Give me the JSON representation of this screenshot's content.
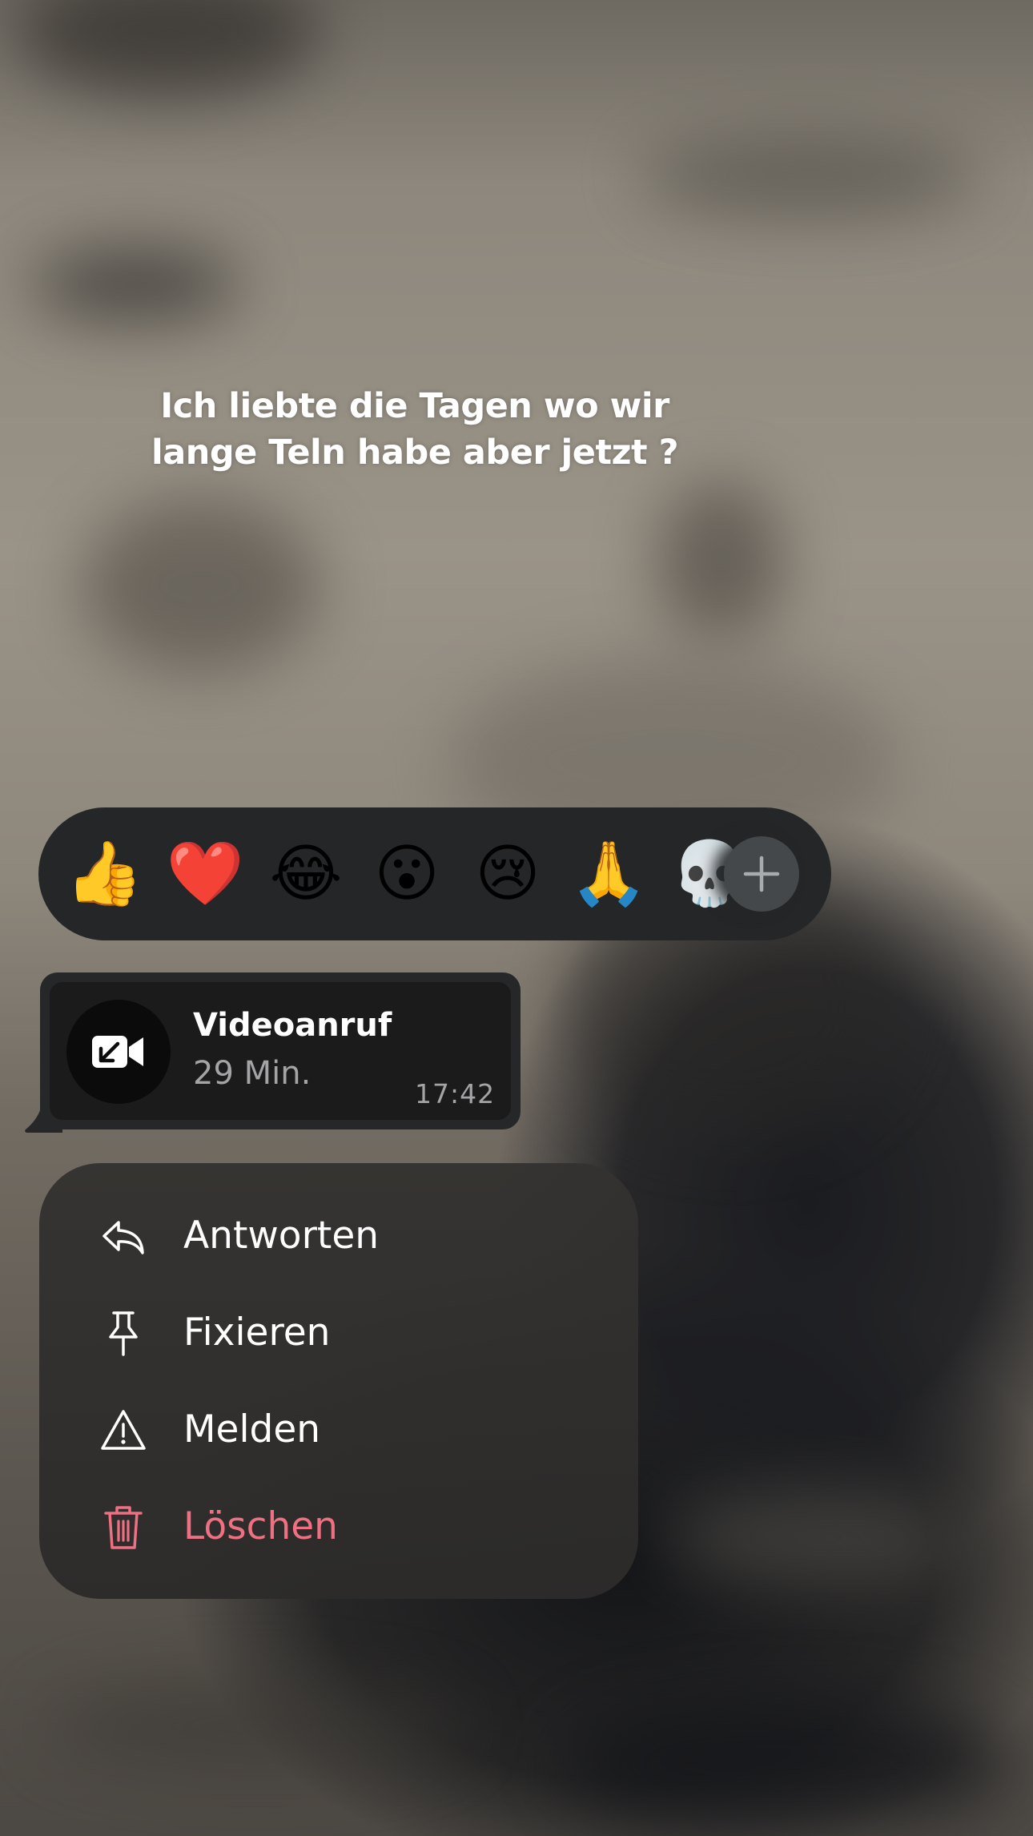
{
  "overlay_text": {
    "line1": "Ich liebte die Tagen wo wir",
    "line2": "lange Teln habe aber jetzt ?"
  },
  "reactions": [
    {
      "emoji": "👍",
      "icon": "thumbs-up"
    },
    {
      "emoji": "❤️",
      "icon": "red-heart"
    },
    {
      "emoji": "😂",
      "icon": "tears-of-joy"
    },
    {
      "emoji": "😮",
      "icon": "surprised-face"
    },
    {
      "emoji": "😢",
      "icon": "crying-face"
    },
    {
      "emoji": "🙏",
      "icon": "folded-hands"
    },
    {
      "emoji": "💀",
      "icon": "skull"
    }
  ],
  "reactions_more": {
    "icon": "plus-icon"
  },
  "call_message": {
    "title": "Videoanruf",
    "duration": "29 Min.",
    "time": "17:42",
    "icon": "incoming-video-call-icon"
  },
  "context_menu": {
    "items": [
      {
        "label": "Antworten",
        "icon": "reply-icon"
      },
      {
        "label": "Fixieren",
        "icon": "pin-icon"
      },
      {
        "label": "Melden",
        "icon": "warning-icon"
      },
      {
        "label": "Löschen",
        "icon": "trash-icon"
      }
    ]
  },
  "colors": {
    "danger": "#ef6f83",
    "menu_background": "#343230",
    "reaction_bar_background": "#242628",
    "bubble_background": "#1b1b1c"
  }
}
